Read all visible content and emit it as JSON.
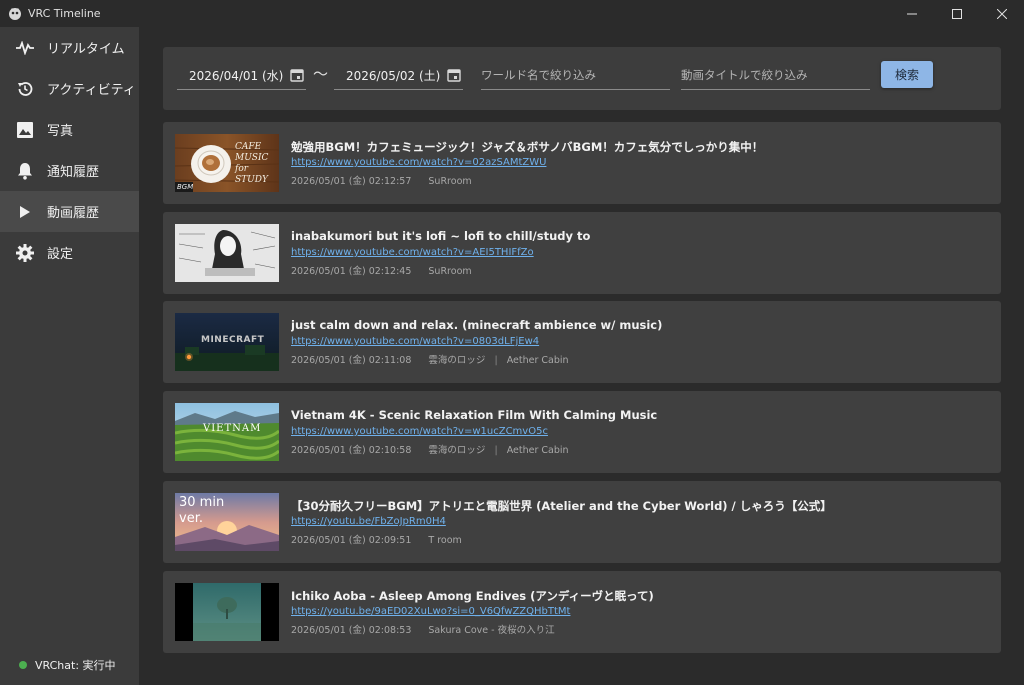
{
  "window": {
    "title": "VRC Timeline",
    "controls": [
      "minimize-icon",
      "maximize-icon",
      "close-icon"
    ]
  },
  "sidebar": {
    "items": [
      {
        "label": "リアルタイム",
        "icon": "pulse-icon",
        "active": false
      },
      {
        "label": "アクティビティ",
        "icon": "history-icon",
        "active": false
      },
      {
        "label": "写真",
        "icon": "image-icon",
        "active": false
      },
      {
        "label": "通知履歴",
        "icon": "bell-icon",
        "active": false
      },
      {
        "label": "動画履歴",
        "icon": "play-icon",
        "active": true
      },
      {
        "label": "設定",
        "icon": "gear-icon",
        "active": false
      }
    ],
    "status": {
      "label": "VRChat: 実行中",
      "color": "#4caf50"
    }
  },
  "search": {
    "date_from": "2026/04/01 (水)",
    "date_to": "2026/05/02 (土)",
    "range_separator": "〜",
    "world_placeholder": "ワールド名で絞り込み",
    "title_placeholder": "動画タイトルで絞り込み",
    "button_label": "検索"
  },
  "videos": [
    {
      "title": "勉強用BGM！カフェミュージック！ジャズ＆ボサノバBGM！カフェ気分でしっかり集中！",
      "url": "https://www.youtube.com/watch?v=02azSAMtZWU",
      "datetime": "2026/05/01 (金) 02:12:57",
      "room": "SuRroom",
      "world": "",
      "thumb_text": "CAFE MUSIC for STUDY",
      "thumb_badge": "BGM"
    },
    {
      "title": "inabakumori but it's lofi ~ lofi to chill/study to",
      "url": "https://www.youtube.com/watch?v=AEI5THIFfZo",
      "datetime": "2026/05/01 (金) 02:12:45",
      "room": "SuRroom",
      "world": "",
      "thumb_text": "",
      "thumb_badge": ""
    },
    {
      "title": "just calm down and relax. (minecraft ambience w/ music)",
      "url": "https://www.youtube.com/watch?v=0803dLFjEw4",
      "datetime": "2026/05/01 (金) 02:11:08",
      "room": "雲海のロッジ",
      "world": "Aether Cabin",
      "thumb_text": "MINECRAFT",
      "thumb_badge": ""
    },
    {
      "title": "Vietnam 4K - Scenic Relaxation Film With Calming Music",
      "url": "https://www.youtube.com/watch?v=w1ucZCmvO5c",
      "datetime": "2026/05/01 (金) 02:10:58",
      "room": "雲海のロッジ",
      "world": "Aether Cabin",
      "thumb_text": "VIETNAM",
      "thumb_badge": ""
    },
    {
      "title": "【30分耐久フリーBGM】アトリエと電脳世界 (Atelier and the Cyber World) / しゃろう【公式】",
      "url": "https://youtu.be/FbZoJpRm0H4",
      "datetime": "2026/05/01 (金) 02:09:51",
      "room": "T room",
      "world": "",
      "thumb_text": "30 min ver.",
      "thumb_badge": ""
    },
    {
      "title": "Ichiko Aoba - Asleep Among Endives (アンディーヴと眠って)",
      "url": "https://youtu.be/9aED02XuLwo?si=0_V6QfwZZQHbTtMt",
      "datetime": "2026/05/01 (金) 02:08:53",
      "room": "Sakura Cove - 夜桜の入り江",
      "world": "",
      "thumb_text": "",
      "thumb_badge": ""
    }
  ]
}
